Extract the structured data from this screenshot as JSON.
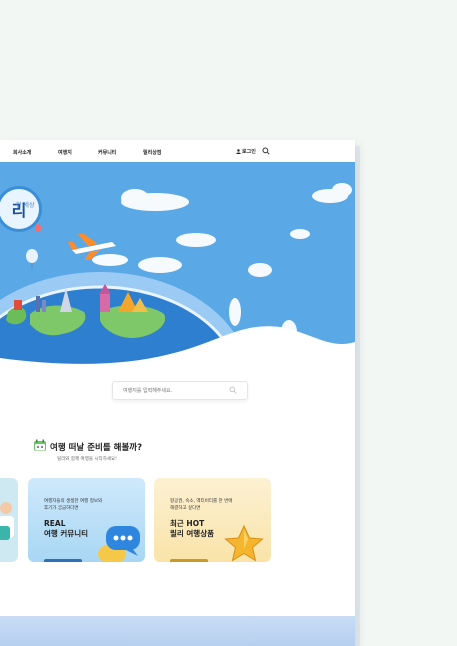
{
  "nav": {
    "items": [
      "회사소개",
      "여행지",
      "커뮤니티",
      "릴리상점"
    ],
    "login_label": "로그인"
  },
  "hero": {
    "title": "리",
    "subtitle": "한 세상"
  },
  "search": {
    "placeholder": "여행지를 입력해주세요."
  },
  "section": {
    "title": "여행 떠날 준비를 해볼까?",
    "subtitle": "릴리와 함께 여행을 시작하세요!"
  },
  "cards": [
    {
      "desc_lines": [
        "여행자들의 생생한 여행 정보와",
        "후기가 궁금하다면"
      ],
      "title_lines": [
        "REAL",
        "여행 커뮤니티"
      ]
    },
    {
      "desc_lines": [
        "항공권, 숙소, 액티비티를 한 번에",
        "해결하고 싶다면"
      ],
      "title_lines": [
        "최근 HOT",
        "릴리 여행상품"
      ]
    }
  ],
  "colors": {
    "sky": "#5ba8e6",
    "ocean": "#2f7fd0",
    "card_blue": "#a8d6f4",
    "card_yellow": "#f9e3a8"
  }
}
